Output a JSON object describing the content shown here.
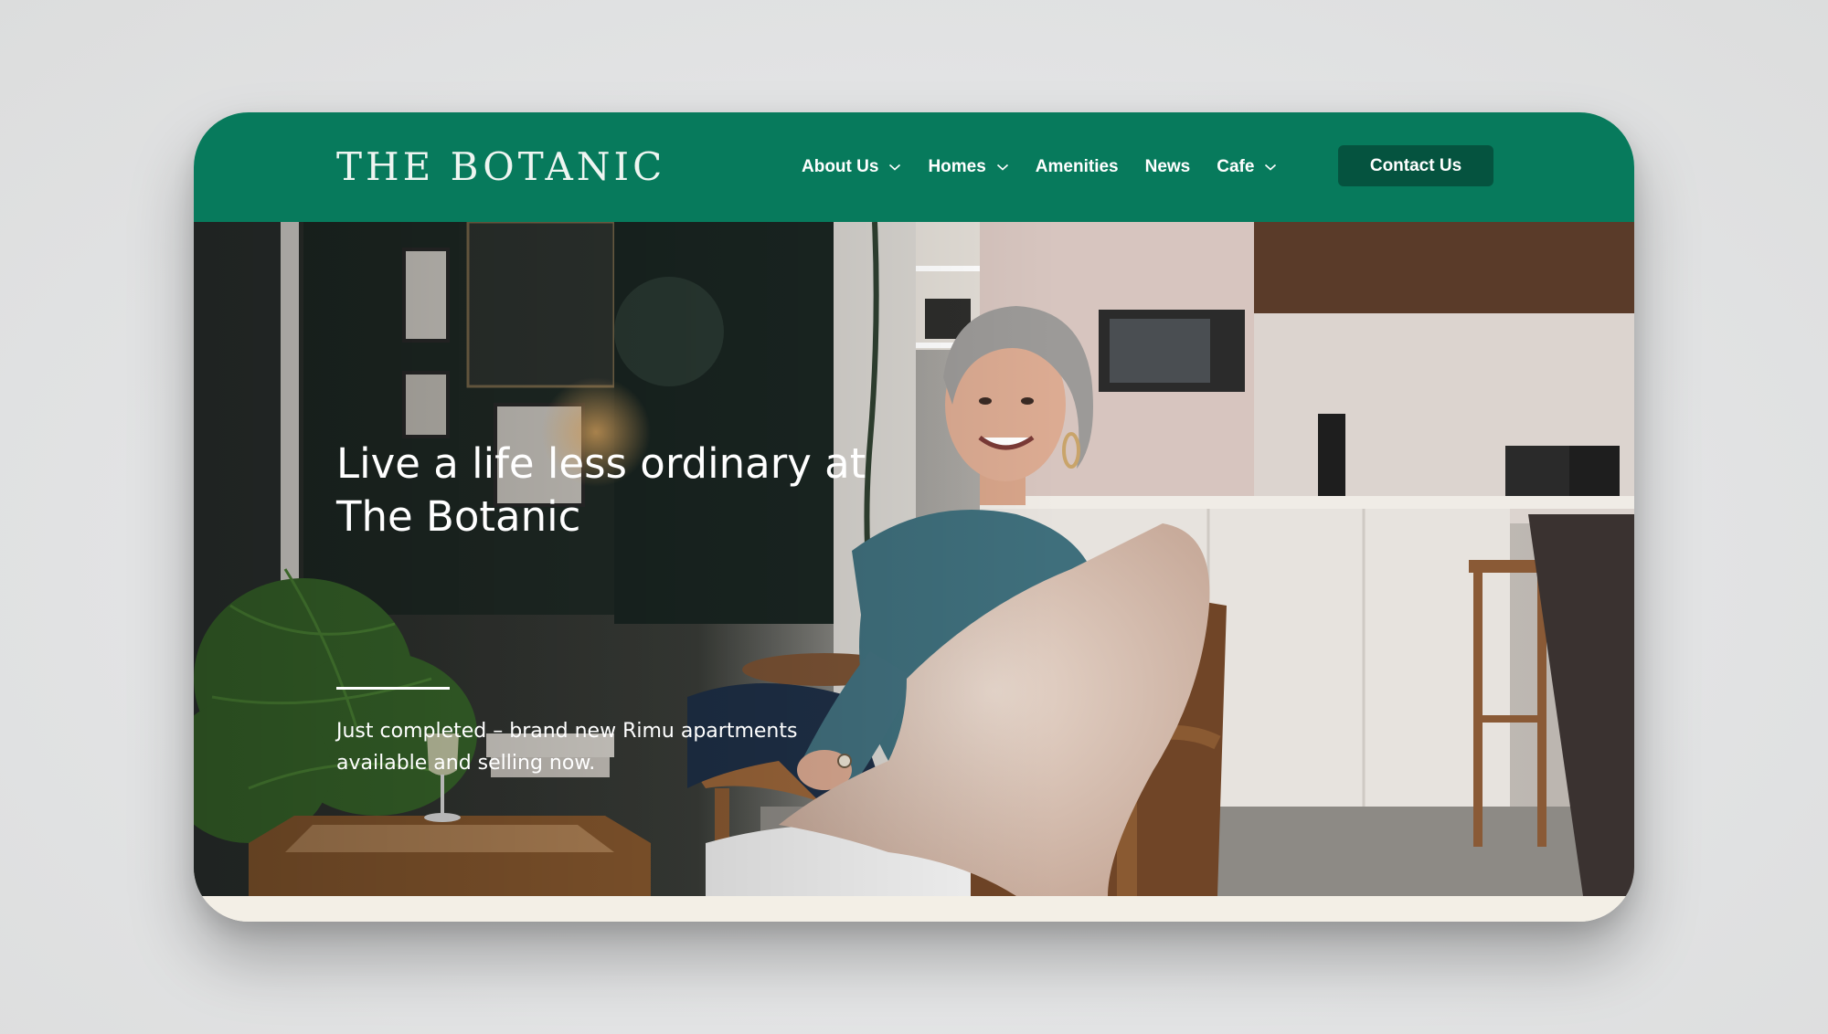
{
  "brand": {
    "name": "THE BOTANIC",
    "primary_color": "#077a5c",
    "button_color": "#05533f",
    "footer_color": "#f3efe6"
  },
  "nav": {
    "items": [
      {
        "label": "About Us",
        "has_dropdown": true
      },
      {
        "label": "Homes",
        "has_dropdown": true
      },
      {
        "label": "Amenities",
        "has_dropdown": false
      },
      {
        "label": "News",
        "has_dropdown": false
      },
      {
        "label": "Cafe",
        "has_dropdown": true
      }
    ],
    "contact_label": "Contact Us"
  },
  "hero": {
    "headline": "Live a life less ordinary at The Botanic",
    "subtext": "Just completed – brand new Rimu apartments available and selling now."
  }
}
